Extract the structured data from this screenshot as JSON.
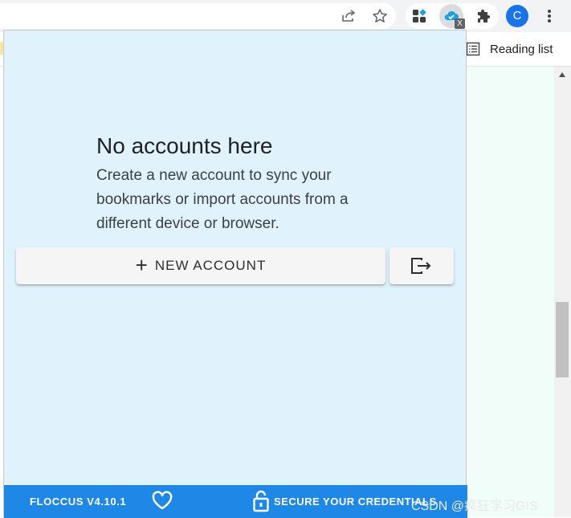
{
  "browser": {
    "reading_list_label": "Reading list",
    "avatar_letter": "C",
    "active_extension_badge": "X",
    "icons": [
      "share-icon",
      "star-icon",
      "extension-apps-icon",
      "floccus-icon",
      "puzzle-icon",
      "more-vert-icon",
      "reading-list-icon"
    ]
  },
  "popup": {
    "empty_title": "No accounts here",
    "empty_description": "Create a new account to sync your bookmarks or import accounts from a different device or browser.",
    "new_account_label": "NEW ACCOUNT",
    "new_account_icon": "plus-icon",
    "import_icon": "import-export-icon",
    "footer": {
      "version": "FLOCCUS V4.10.1",
      "heart_icon": "heart-icon",
      "lock_icon": "lock-icon",
      "secure_label": "SECURE YOUR CREDENTIALS"
    }
  },
  "watermark": "CSDN @疯狂学习GIS",
  "colors": {
    "popup_bg": "#e0f3fd",
    "footer_bg": "#1f87e5",
    "button_bg": "#f5f5f5",
    "page_bg": "#f1fdf8"
  }
}
